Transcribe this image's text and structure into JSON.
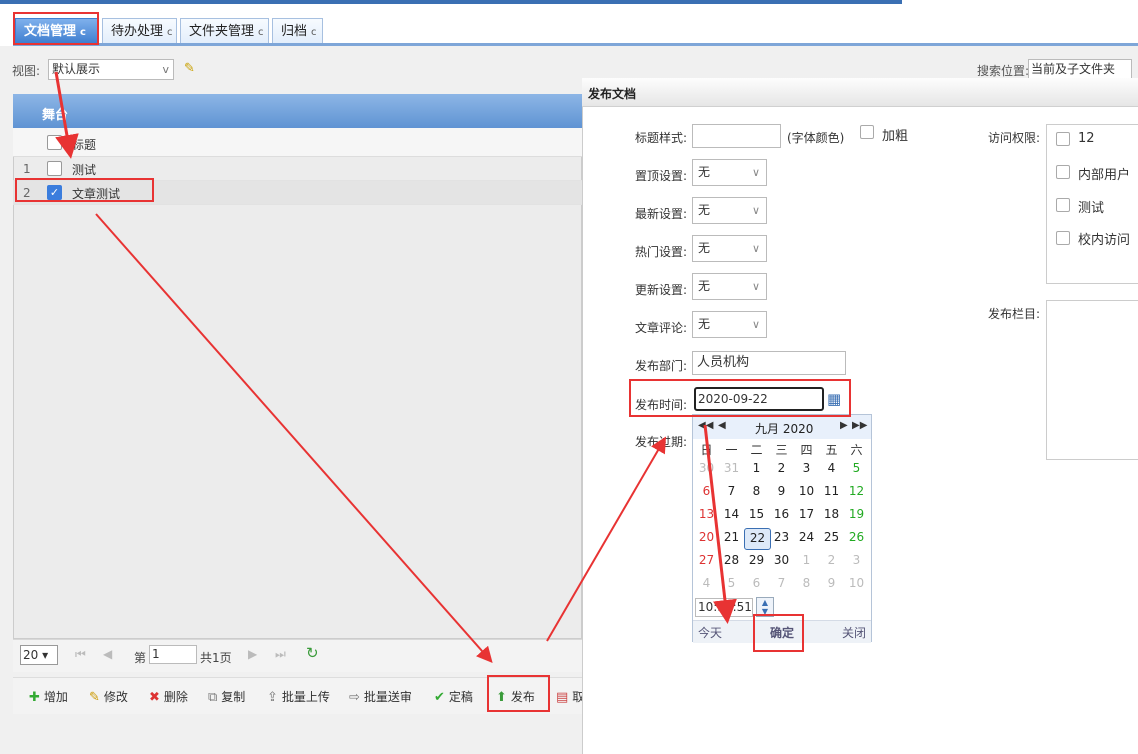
{
  "tabs": [
    {
      "label": "文档管理",
      "refresh": "c"
    },
    {
      "label": "待办处理",
      "refresh": "c"
    },
    {
      "label": "文件夹管理",
      "refresh": "c"
    },
    {
      "label": "归档",
      "refresh": "c"
    }
  ],
  "view": {
    "label": "视图:",
    "value": "默认展示",
    "dropdown": "v"
  },
  "search_location": {
    "label": "搜索位置:",
    "value": "当前及子文件夹"
  },
  "grid": {
    "title": "舞台",
    "column_title": "标题",
    "rows": [
      {
        "num": "1",
        "title": "测试",
        "checked": false
      },
      {
        "num": "2",
        "title": "文章测试",
        "checked": true
      }
    ]
  },
  "pager": {
    "page_size": "20",
    "page_prefix": "第",
    "page_value": "1",
    "page_total": "共1页"
  },
  "toolbar": {
    "add": "增加",
    "edit": "修改",
    "delete": "删除",
    "copy": "复制",
    "batch_upload": "批量上传",
    "batch_send": "批量送审",
    "finalize": "定稿",
    "publish": "发布",
    "cancel": "取"
  },
  "dialog": {
    "title": "发布文档",
    "title_style_label": "标题样式:",
    "font_color_hint": "(字体颜色)",
    "bold_label": "加粗",
    "top_label": "置顶设置:",
    "top_value": "无",
    "new_label": "最新设置:",
    "new_value": "无",
    "hot_label": "热门设置:",
    "hot_value": "无",
    "update_label": "更新设置:",
    "update_value": "无",
    "comment_label": "文章评论:",
    "comment_value": "无",
    "dept_label": "发布部门:",
    "dept_value": "人员机构",
    "time_label": "发布时间:",
    "time_value": "2020-09-22 10:37:51",
    "expire_label": "发布过期:",
    "access_label": "访问权限:",
    "access_options": [
      "12",
      "内部用户",
      "测试",
      "校内访问"
    ],
    "column_label": "发布栏目:"
  },
  "calendar": {
    "month": "九月 2020",
    "weekdays": [
      "日",
      "一",
      "二",
      "三",
      "四",
      "五",
      "六"
    ],
    "weeks": [
      [
        "30",
        "31",
        "1",
        "2",
        "3",
        "4",
        "5"
      ],
      [
        "6",
        "7",
        "8",
        "9",
        "10",
        "11",
        "12"
      ],
      [
        "13",
        "14",
        "15",
        "16",
        "17",
        "18",
        "19"
      ],
      [
        "20",
        "21",
        "22",
        "23",
        "24",
        "25",
        "26"
      ],
      [
        "27",
        "28",
        "29",
        "30",
        "1",
        "2",
        "3"
      ],
      [
        "4",
        "5",
        "6",
        "7",
        "8",
        "9",
        "10"
      ]
    ],
    "selected_day": "22",
    "time": "10:37:51",
    "today_label": "今天",
    "confirm_label": "确定",
    "close_label": "关闭"
  },
  "colors": {
    "accent": "#3a6fb3",
    "highlight": "#e83333",
    "saturday": "#22aa22",
    "sunday": "#dd3333"
  }
}
